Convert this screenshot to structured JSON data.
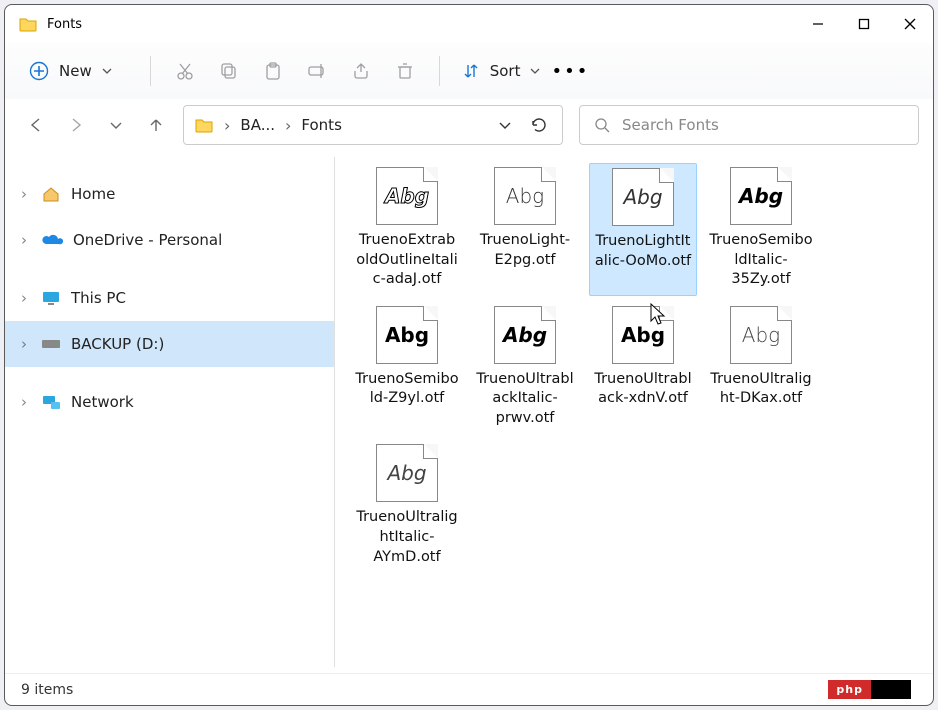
{
  "window": {
    "title": "Fonts"
  },
  "toolbar": {
    "new_label": "New",
    "sort_label": "Sort"
  },
  "breadcrumb": {
    "seg1": "BA...",
    "seg2": "Fonts"
  },
  "search": {
    "placeholder": "Search Fonts"
  },
  "sidebar": {
    "items": [
      {
        "label": "Home"
      },
      {
        "label": "OneDrive - Personal"
      },
      {
        "label": "This PC"
      },
      {
        "label": "BACKUP (D:)"
      },
      {
        "label": "Network"
      }
    ]
  },
  "files": [
    {
      "name": "TruenoExtraboldOutlineItalic-adaJ.otf",
      "variant": "outline"
    },
    {
      "name": "TruenoLight-E2pg.otf",
      "variant": "light"
    },
    {
      "name": "TruenoLightItalic-OoMo.otf",
      "variant": "lightitalic",
      "selected": true
    },
    {
      "name": "TruenoSemiboldItalic-35Zy.otf",
      "variant": "semibolditalic"
    },
    {
      "name": "TruenoSemibold-Z9yl.otf",
      "variant": "semibold"
    },
    {
      "name": "TruenoUltrablackItalic-prwv.otf",
      "variant": "ultrablackitalic"
    },
    {
      "name": "TruenoUltrablack-xdnV.otf",
      "variant": "ultrablack"
    },
    {
      "name": "TruenoUltralight-DKax.otf",
      "variant": "ultralight"
    },
    {
      "name": "TruenoUltralightItalic-AYmD.otf",
      "variant": "ultralightitalic"
    }
  ],
  "status": {
    "text": "9 items"
  },
  "badge": {
    "text": "php"
  },
  "thumb_glyph": "Abg"
}
